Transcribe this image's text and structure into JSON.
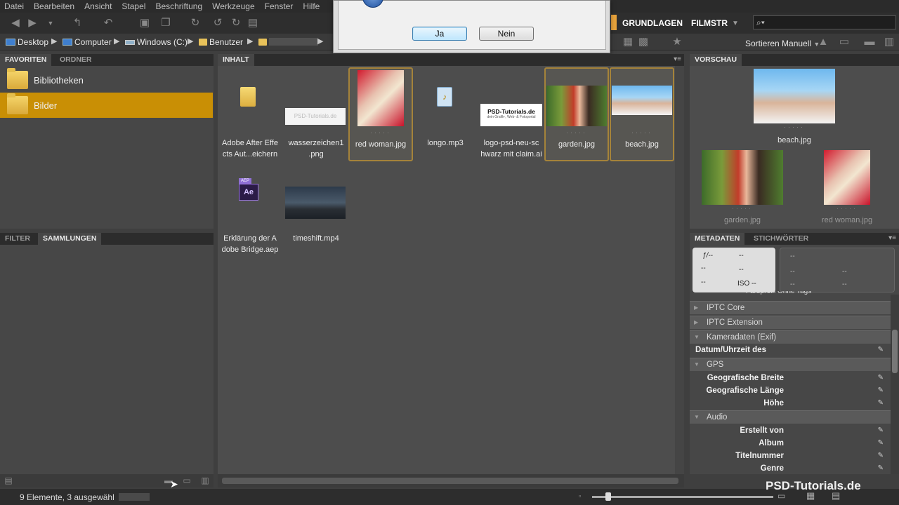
{
  "menu": [
    "Datei",
    "Bearbeiten",
    "Ansicht",
    "Stapel",
    "Beschriftung",
    "Werkzeuge",
    "Fenster",
    "Hilfe"
  ],
  "workspaces": {
    "active": "GRUNDLAGEN",
    "second": "FILMSTR"
  },
  "search": {
    "placeholder": "⌕▾"
  },
  "path": {
    "desktop": "Desktop",
    "computer": "Computer",
    "drive": "Windows (C:)",
    "users": "Benutzer"
  },
  "sort": {
    "label": "Sortieren Manuell"
  },
  "dialog": {
    "yes": "Ja",
    "no": "Nein"
  },
  "left_top": {
    "tabs": [
      "FAVORITEN",
      "ORDNER"
    ],
    "items": [
      {
        "label": "Bibliotheken"
      },
      {
        "label": "Bilder"
      }
    ]
  },
  "left_bottom": {
    "tabs": [
      "FILTER",
      "SAMMLUNGEN"
    ]
  },
  "content": {
    "tab": "INHALT",
    "items": [
      {
        "cap1": "Adobe After Effe",
        "cap2": "cts Aut...eichern",
        "type": "folder"
      },
      {
        "cap1": "wasserzeichen1",
        "cap2": ".png",
        "type": "watermark-png",
        "logo": "PSD-Tutorials.de"
      },
      {
        "cap1": "red woman.jpg",
        "cap2": "",
        "type": "photo",
        "selected": true
      },
      {
        "cap1": "longo.mp3",
        "cap2": "",
        "type": "audio"
      },
      {
        "cap1": "logo-psd-neu-sc",
        "cap2": "hwarz mit claim.ai",
        "type": "logo",
        "logo": "PSD-Tutorials.de",
        "sub": "dein Grafik-, Web- & Fotoportal"
      },
      {
        "cap1": "garden.jpg",
        "cap2": "",
        "type": "photo",
        "selected": true
      },
      {
        "cap1": "beach.jpg",
        "cap2": "",
        "type": "photo",
        "selected": true
      },
      {
        "cap1": "Erklärung der A",
        "cap2": "dobe Bridge.aep",
        "type": "aep",
        "icon_text": "Ae",
        "badge": "AEP"
      },
      {
        "cap1": "timeshift.mp4",
        "cap2": "",
        "type": "video"
      }
    ]
  },
  "preview": {
    "tab": "VORSCHAU",
    "items": [
      {
        "label": "beach.jpg"
      },
      {
        "label": "garden.jpg"
      },
      {
        "label": "red woman.jpg"
      }
    ]
  },
  "metadata": {
    "tabs": [
      "METADATEN",
      "STICHWÖRTER"
    ],
    "camera": {
      "fstop": "ƒ/--",
      "shutter": "--",
      "a": "--",
      "b": "--",
      "c": "--",
      "iso": "ISO --",
      "r1": "--",
      "r2": "--",
      "r3": "--",
      "r4": "--",
      "r5": "--"
    },
    "partial_row": "Farbprofil  Ohne Tags",
    "sections": [
      "IPTC Core",
      "IPTC Extension",
      "Kameradaten (Exif)",
      "GPS",
      "Audio"
    ],
    "exif_row": "Datum/Uhrzeit des O...",
    "gps_rows": [
      "Geografische Breite",
      "Geografische Länge",
      "Höhe"
    ],
    "audio_rows": [
      "Erstellt von",
      "Album",
      "Titelnummer",
      "Genre"
    ]
  },
  "status": {
    "text": "9 Elemente, 3 ausgewähl"
  },
  "watermark": "PSD-Tutorials.de",
  "colors": {
    "selection": "#c98f05",
    "selected_border": "#a5833a",
    "workspace_accent": "#e8a33c"
  }
}
